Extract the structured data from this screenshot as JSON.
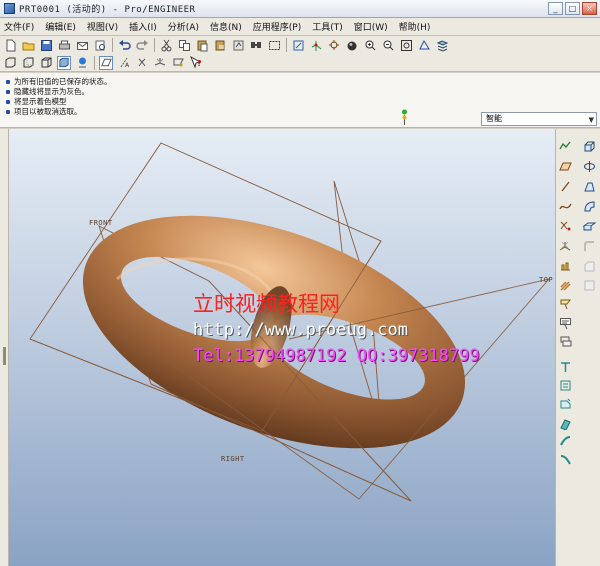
{
  "window": {
    "title": "PRT0001 (活动的) - Pro/ENGINEER",
    "minimize_glyph": "_",
    "maximize_glyph": "□",
    "close_glyph": "×"
  },
  "menu": [
    "文件(F)",
    "编辑(E)",
    "视图(V)",
    "插入(I)",
    "分析(A)",
    "信息(N)",
    "应用程序(P)",
    "工具(T)",
    "窗口(W)",
    "帮助(H)"
  ],
  "messages": [
    "为所有旧值的已保存的状态。",
    "隐藏线将显示为灰色。",
    "将显示着色模型",
    "项目以被取消选取。"
  ],
  "filter": {
    "value": "智能"
  },
  "datums": {
    "front": "FRONT",
    "top": "TOP",
    "right": "RIGHT"
  },
  "watermark": {
    "title": "立时视频教程网",
    "url": "http://www.proeug.com",
    "contact": "Tel:13794987192  QQ:397318799"
  },
  "colors": {
    "model_base": "#8a5530",
    "model_highlight": "#e9b98a",
    "datum_plane": "#8a5a3a",
    "watermark_title": "#ff2020",
    "watermark_contact": "#ff44ff"
  },
  "icons": {
    "toolbar1": [
      "new-file-icon",
      "open-folder-icon",
      "save-icon",
      "print-icon",
      "email-icon",
      "print-preview-icon",
      "undo-icon",
      "redo-icon",
      "cut-icon",
      "copy-icon",
      "paste-icon",
      "paste-special-icon",
      "regenerate-icon",
      "find-icon",
      "select-box-icon",
      "datum-display-icon",
      "axis-display-icon",
      "point-display-icon",
      "csys-display-icon",
      "shade-icon",
      "zoom-in-icon",
      "zoom-out-icon",
      "refit-icon",
      "reorient-icon",
      "saved-views-icon"
    ],
    "toolbar2": [
      "wireframe-icon",
      "hidden-line-icon",
      "no-hidden-icon",
      "shading-icon",
      "model-tree-icon",
      "datum-plane-toggle-icon",
      "datum-axis-toggle-icon",
      "datum-point-toggle-icon",
      "csys-toggle-icon",
      "annotation-toggle-icon",
      "context-help-icon"
    ],
    "rightbar": [
      "sketch-icon",
      "plane-icon",
      "axis-icon",
      "curve-icon",
      "point-icon",
      "csys-icon",
      "analysis-icon",
      "extrude-icon",
      "revolve-icon",
      "sweep-icon",
      "blend-icon",
      "hole-icon",
      "round-icon",
      "chamfer-icon",
      "shell-icon",
      "rib-icon",
      "draft-icon",
      "pattern-icon",
      "mirror-icon",
      "merge-icon",
      "trim-icon",
      "offset-icon",
      "thicken-icon",
      "solidify-icon"
    ]
  }
}
